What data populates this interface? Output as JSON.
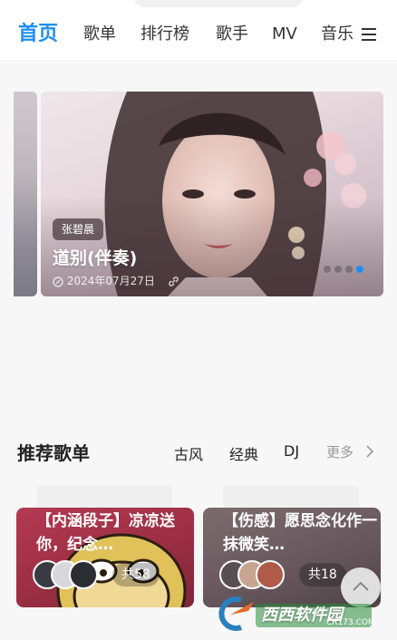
{
  "nav": {
    "items": [
      "首页",
      "歌单",
      "排行榜",
      "歌手",
      "MV",
      "音乐"
    ],
    "active_index": 0
  },
  "icons": {
    "menu": "hamburger-menu-icon",
    "date": "clock-icon",
    "link": "link-icon",
    "more": "chevron-right-icon",
    "scroll_top": "chevron-up-icon"
  },
  "colors": {
    "accent": "#1f8ff0",
    "card1": "#9e2f45",
    "card2": "#6a5a60"
  },
  "banner": {
    "artist": "张碧晨",
    "title": "道别(伴奏)",
    "date": "2024年07月27日",
    "slide_count": 4,
    "active_slide": 3
  },
  "playlists": {
    "section_title": "推荐歌单",
    "categories": [
      "古风",
      "经典",
      "DJ"
    ],
    "more_label": "更多",
    "cards": [
      {
        "title": "【内涵段子】凉凉送你，纪念…",
        "count": "共58"
      },
      {
        "title": "【伤感】愿思念化作一抹微笑…",
        "count": "共18"
      }
    ]
  },
  "watermark": {
    "brand": "西西软件园",
    "site": "CR173.COM"
  }
}
